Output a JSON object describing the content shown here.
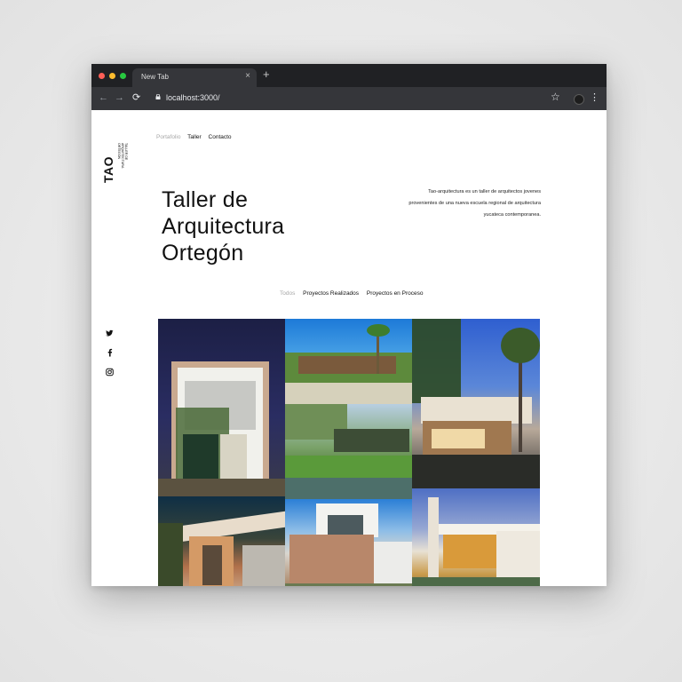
{
  "browser": {
    "tab_title": "New Tab",
    "tab_close": "×",
    "new_tab": "+",
    "url": "localhost:3000/",
    "back": "←",
    "forward": "→",
    "reload": "⟳",
    "star": "☆",
    "menu": "⋮"
  },
  "logo": {
    "mark": "TAO",
    "subtitle_lines": [
      "TALLER DE",
      "ARQUITECTURA",
      "ORTEGÓN"
    ]
  },
  "nav": {
    "items": [
      {
        "label": "Portafolio",
        "active": false
      },
      {
        "label": "Taller",
        "active": true
      },
      {
        "label": "Contacto",
        "active": true
      }
    ]
  },
  "hero": {
    "title_lines": [
      "Taller de",
      "Arquitectura",
      "Ortegón"
    ],
    "description_lines": [
      "Tao-arquitectura es un taller de arquitectos jovenes",
      "provenientes de una nueva escuela regional de arquitectura",
      "yucateca contemporanea."
    ]
  },
  "filters": {
    "items": [
      {
        "label": "Todos",
        "active": false
      },
      {
        "label": "Proyectos Realizados",
        "active": true
      },
      {
        "label": "Proyectos en Proceso",
        "active": true
      }
    ]
  },
  "social": {
    "twitter": "twitter-icon",
    "facebook": "facebook-icon",
    "instagram": "instagram-icon"
  },
  "gallery": {
    "photos": [
      "modern-house-night-facade",
      "house-with-palm-trees",
      "green-roof-house-garden",
      "house-pool-night-terrace",
      "house-night-lit-garage",
      "white-modern-house-wood-wall",
      "white-house-pool-evening"
    ]
  }
}
